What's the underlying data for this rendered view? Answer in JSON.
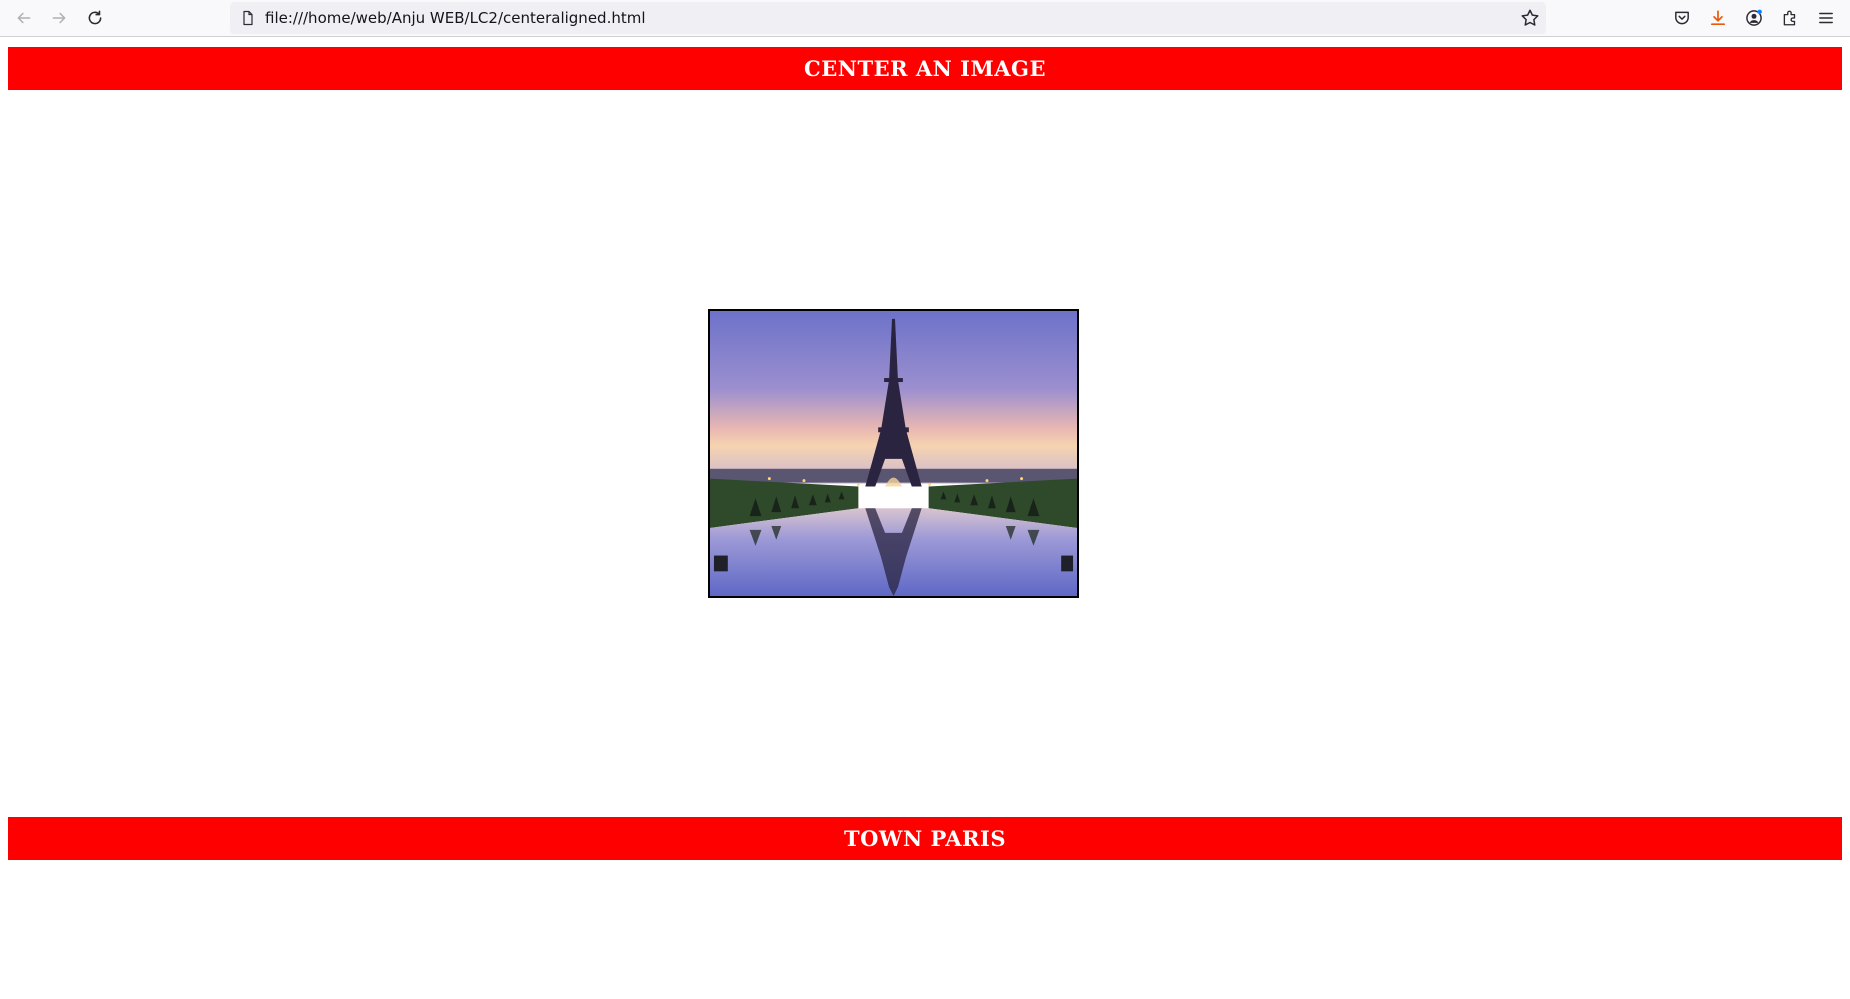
{
  "browser": {
    "url": "file:///home/web/Anju WEB/LC2/centeraligned.html",
    "icons": [
      "back-arrow-icon",
      "forward-arrow-icon",
      "reload-icon",
      "page-icon",
      "bookmark-star-icon",
      "pocket-icon",
      "download-icon",
      "account-icon",
      "extensions-icon",
      "menu-icon"
    ],
    "download_color": "#e8590c"
  },
  "page": {
    "header_title": "CENTER AN IMAGE",
    "footer_title": "TOWN PARIS",
    "banner_color": "#ff0000",
    "image_alt": "Eiffel Tower at dusk reflected in the Trocadéro fountains"
  }
}
